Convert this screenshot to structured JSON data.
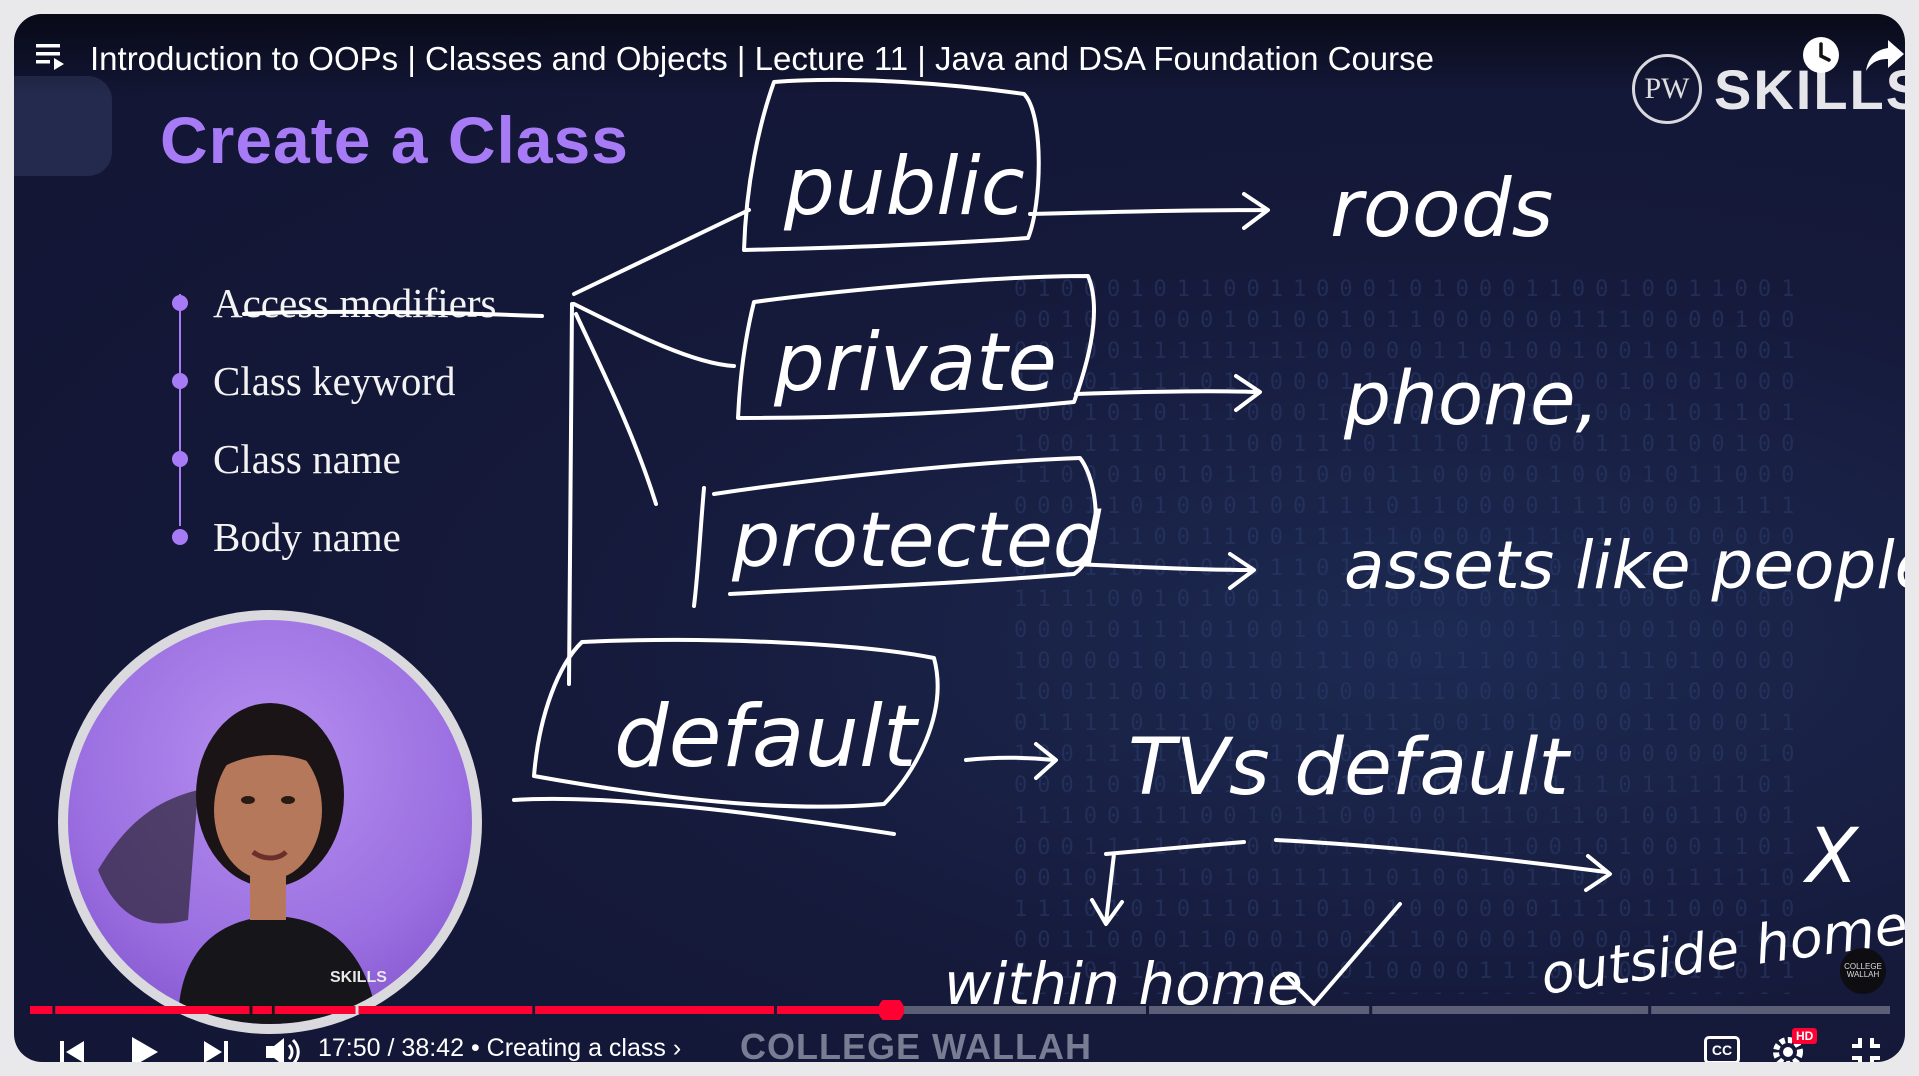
{
  "video": {
    "title": "Introduction to OOPs | Classes and Objects | Lecture 11 | Java and DSA Foundation Course",
    "channel_watermark": "COLLEGE WALLAH",
    "logo_text": "SKILLS",
    "logo_monogram": "PW",
    "corner_badge": "COLLEGE WALLAH",
    "shirt_logo": "SKILLS"
  },
  "slide": {
    "title": "Create a Class",
    "bullets": [
      {
        "label": "Access modifiers"
      },
      {
        "label": "Class keyword"
      },
      {
        "label": "Class name"
      },
      {
        "label": "Body name"
      }
    ]
  },
  "annotations": {
    "modifiers": [
      "public",
      "private",
      "protected",
      "default"
    ],
    "examples": [
      "roods",
      "phone,",
      "assets like people",
      "TVs default"
    ],
    "branches": [
      "within home",
      "outside home"
    ],
    "mark": "X"
  },
  "player": {
    "current_time": "17:50",
    "duration": "38:42",
    "chapter": "Creating a class",
    "progress": 0.463,
    "quality_badge": "HD",
    "cc_label": "CC"
  },
  "icons": {
    "menu": "playlist-icon",
    "watch_later": "clock-icon",
    "share": "share-icon",
    "prev": "previous-icon",
    "play": "play-icon",
    "next": "next-icon",
    "volume": "volume-icon",
    "cc": "captions-icon",
    "settings": "gear-icon",
    "fullscreen": "exit-fullscreen-icon"
  },
  "colors": {
    "accent_purple": "#a77bf5",
    "progress_red": "#ff0033",
    "background": "#141838"
  }
}
